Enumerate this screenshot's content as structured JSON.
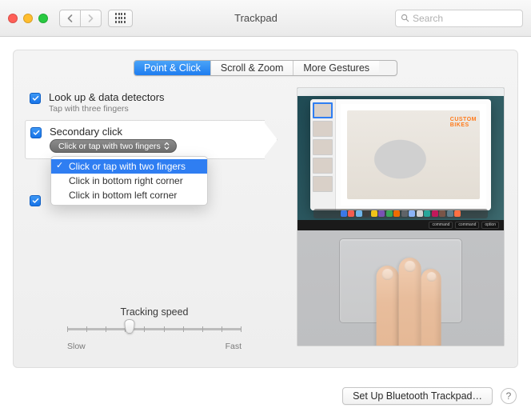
{
  "window": {
    "title": "Trackpad",
    "search_placeholder": "Search"
  },
  "tabs": {
    "point_click": "Point & Click",
    "scroll_zoom": "Scroll & Zoom",
    "more_gestures": "More Gestures"
  },
  "options": {
    "lookup": {
      "label": "Look up & data detectors",
      "sub": "Tap with three fingers"
    },
    "secondary": {
      "label": "Secondary click",
      "selected": "Click or tap with two fingers"
    }
  },
  "dropdown": {
    "opt1": "Click or tap with two fingers",
    "opt2": "Click in bottom right corner",
    "opt3": "Click in bottom left corner"
  },
  "slider": {
    "title": "Tracking speed",
    "min": "Slow",
    "max": "Fast"
  },
  "preview": {
    "hero_line1": "CUSTOM",
    "hero_line2": "BIKES",
    "key_command": "command",
    "key_option": "option"
  },
  "footer": {
    "bluetooth": "Set Up Bluetooth Trackpad…",
    "help": "?"
  }
}
